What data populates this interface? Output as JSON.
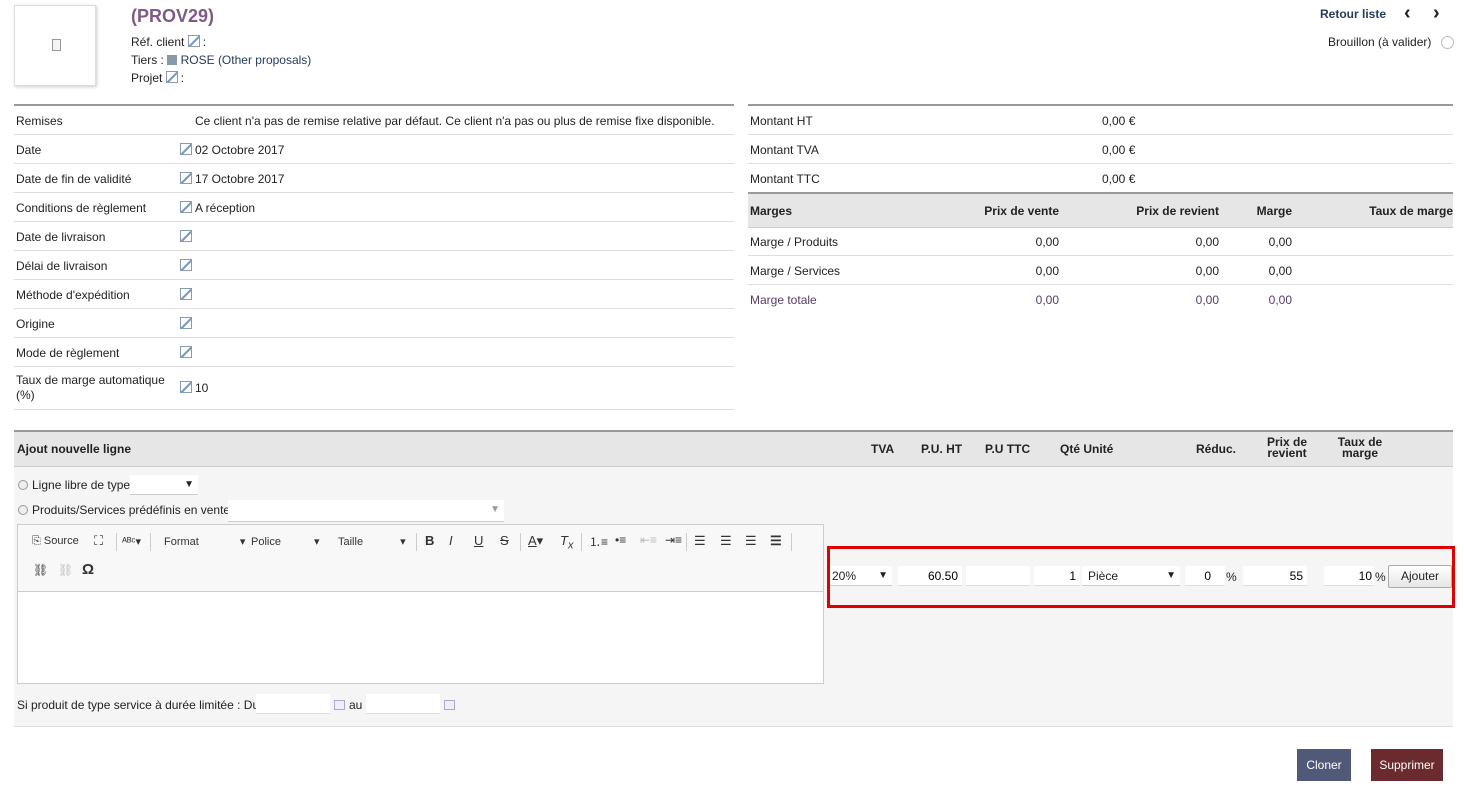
{
  "header": {
    "ref": "(PROV29)",
    "ref_client_label": "Réf. client",
    "ref_client_suffix": ":",
    "tiers_label": "Tiers :",
    "tiers_name": "ROSE",
    "tiers_other": "(Other proposals)",
    "projet_label": "Projet",
    "projet_suffix": ":",
    "back_list": "Retour liste",
    "prev": "‹",
    "next": "›",
    "status": "Brouillon (à valider)"
  },
  "left_fields": [
    {
      "label": "Remises",
      "value": "Ce client n'a pas de remise relative par défaut. Ce client n'a pas ou plus de remise fixe disponible."
    },
    {
      "label": "Date",
      "value": "02 Octobre 2017"
    },
    {
      "label": "Date de fin de validité",
      "value": "17 Octobre 2017"
    },
    {
      "label": "Conditions de règlement",
      "value": "A réception"
    },
    {
      "label": "Date de livraison",
      "value": ""
    },
    {
      "label": "Délai de livraison",
      "value": ""
    },
    {
      "label": "Méthode d'expédition",
      "value": ""
    },
    {
      "label": "Origine",
      "value": ""
    },
    {
      "label": "Mode de règlement",
      "value": ""
    },
    {
      "label": "Taux de marge automatique (%)",
      "value": "10"
    }
  ],
  "amounts": [
    {
      "label": "Montant HT",
      "value": "0,00 €"
    },
    {
      "label": "Montant TVA",
      "value": "0,00 €"
    },
    {
      "label": "Montant TTC",
      "value": "0,00 €"
    }
  ],
  "margins": {
    "headers": [
      "Marges",
      "Prix de vente",
      "Prix de revient",
      "Marge",
      "Taux de marge"
    ],
    "rows": [
      {
        "label": "Marge / Produits",
        "sale": "0,00",
        "cost": "0,00",
        "margin": "0,00"
      },
      {
        "label": "Marge / Services",
        "sale": "0,00",
        "cost": "0,00",
        "margin": "0,00"
      },
      {
        "label": "Marge totale",
        "sale": "0,00",
        "cost": "0,00",
        "margin": "0,00"
      }
    ]
  },
  "add_line": {
    "title": "Ajout nouvelle ligne",
    "col_tva": "TVA",
    "col_pu_ht": "P.U. HT",
    "col_pu_ttc": "P.U TTC",
    "col_qty": "Qté Unité",
    "col_reduc": "Réduc.",
    "col_cost_1": "Prix de",
    "col_cost_2": "revient",
    "col_rate_1": "Taux de",
    "col_rate_2": "marge",
    "free_line_label": "Ligne libre de type",
    "predef_label": "Produits/Services prédéfinis en vente",
    "tva": "20%",
    "pu_ht": "60.50",
    "pu_ttc": "",
    "qty": "1",
    "unit": "Pièce",
    "reduc": "0",
    "reduc_unit": "%",
    "cost": "55",
    "rate": "10",
    "rate_unit": "%",
    "add_button": "Ajouter",
    "service_label": "Si produit de type service à durée limitée : Du",
    "service_to": "au"
  },
  "editor": {
    "source": "Source",
    "format": "Format",
    "police": "Police",
    "taille": "Taille",
    "omega": "Ω"
  },
  "actions": {
    "clone": "Cloner",
    "delete": "Supprimer"
  },
  "colors": {
    "title": "#7e5b87",
    "highlight": "#e00000",
    "clone_bg": "#505a78",
    "delete_bg": "#6a2a2e"
  }
}
